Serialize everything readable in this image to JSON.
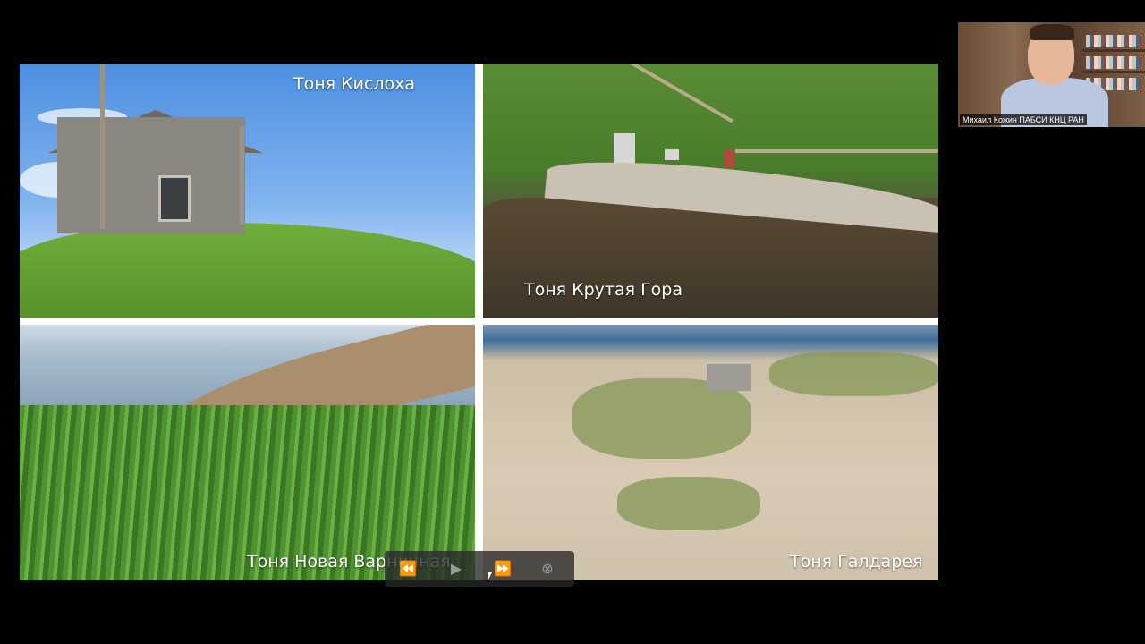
{
  "slide": {
    "panels": [
      {
        "caption": "Тоня Кислоха"
      },
      {
        "caption": "Тоня Крутая Гора"
      },
      {
        "caption": "Тоня Новая Варничная"
      },
      {
        "caption": "Тоня Галдарея"
      }
    ]
  },
  "webcam": {
    "participant_label": "Михаил Кожин  ПАБСИ КНЦ РАН"
  },
  "player": {
    "rewind_icon": "⏪",
    "play_icon": "▶",
    "forward_icon": "⏩",
    "close_icon": "⊗"
  },
  "colors": {
    "background": "#000000",
    "slide_border": "#ffffff",
    "caption_text": "#ffffff"
  }
}
